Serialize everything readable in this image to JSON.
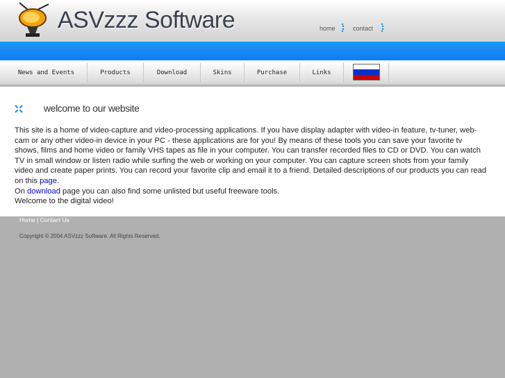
{
  "header": {
    "brand": "ASVzzz Software",
    "logo_icon": "tv-logo-icon",
    "top_links": [
      {
        "label": "home"
      },
      {
        "label": "contact"
      }
    ]
  },
  "nav": {
    "items": [
      {
        "label": "News and Events"
      },
      {
        "label": "Products"
      },
      {
        "label": "Download"
      },
      {
        "label": "Skins"
      },
      {
        "label": "Purchase"
      },
      {
        "label": "Links"
      }
    ],
    "flag_icon": "russian-flag-icon",
    "flag_colors": [
      "#ffffff",
      "#0033cc",
      "#cc0000"
    ]
  },
  "content": {
    "title": "welcome to our website",
    "para1": "This site is a home of video-capture and video-processing applications. If you have display adapter with video-in feature, tv-tuner, web-cam or any other video-in device in your PC - these applications are for you! By means of these tools you can save your favorite tv shows, films and home video or family VHS tapes as file in your computer. You can transfer recorded files to CD or DVD. You can watch TV in small window or listen radio while surfing the web or working on your computer. You can capture screen shots from your family video and create paper prints. You can record your favorite clip and email it to a friend. Detailed descriptions of our products you can read on this ",
    "para1_link": "page",
    "para1_end": ".",
    "line2_pre": "On ",
    "line2_link": "download",
    "line2_post": " page you can also find some unlisted but useful freeware tools.",
    "line3": "Welcome to the digital video!"
  },
  "footer": {
    "home": "Home",
    "sep": " | ",
    "contact": "Contact Us",
    "copyright": "Copyright © 2004 ASVzzz Software. All Rights Reserved."
  },
  "colors": {
    "accent_blue": "#0a7ef7",
    "link": "#0000cc",
    "background_gray": "#b0b0b0"
  }
}
